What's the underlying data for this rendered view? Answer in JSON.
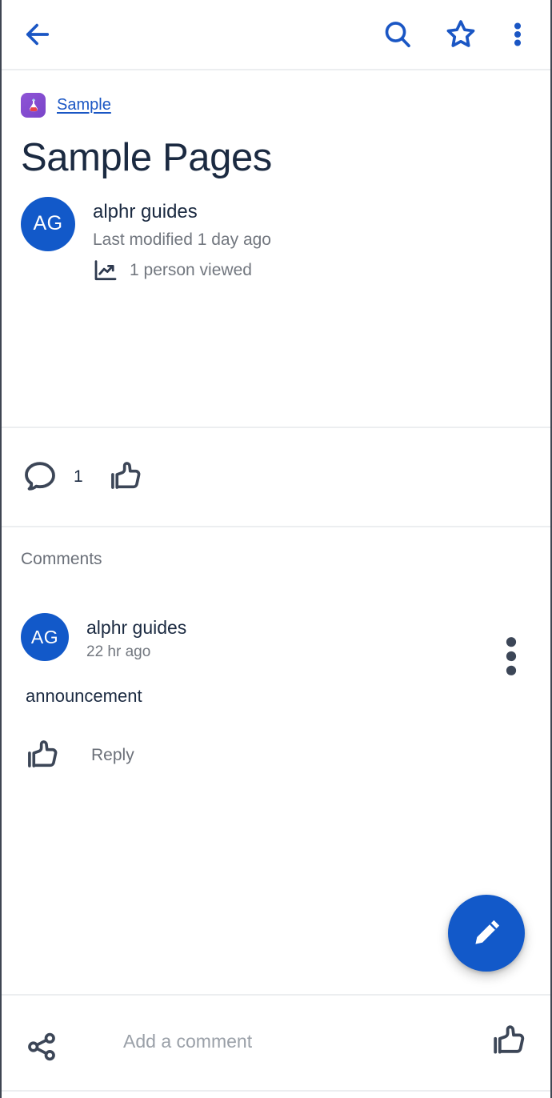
{
  "appbar": {
    "back_icon": "arrow-left-icon",
    "search_icon": "search-icon",
    "favorite_icon": "star-outline-icon",
    "overflow_icon": "more-vertical-icon",
    "icon_color": "#1a56c4"
  },
  "page": {
    "breadcrumb": {
      "space_icon": "flask-icon",
      "space_label": "Sample"
    },
    "title": "Sample Pages",
    "byline": {
      "avatar_initials": "AG",
      "avatar_color": "#1259c9",
      "author": "alphr guides",
      "modified": "Last modified 1 day ago",
      "views_icon": "analytics-chart-icon",
      "views": "1 person viewed"
    }
  },
  "engagement": {
    "comment_icon": "comment-bubble-icon",
    "comment_count": "1",
    "like_icon": "thumbs-up-icon"
  },
  "comments": {
    "heading": "Comments",
    "items": [
      {
        "avatar_initials": "AG",
        "author": "alphr guides",
        "time": "22 hr ago",
        "body": "announcement",
        "like_icon": "thumbs-up-icon",
        "reply_label": "Reply",
        "menu_icon": "more-vertical-icon"
      }
    ]
  },
  "fab": {
    "icon": "pencil-edit-icon",
    "color": "#1259c9"
  },
  "bottombar": {
    "share_icon": "share-icon",
    "comment_placeholder": "Add a comment",
    "comment_value": "",
    "like_icon": "thumbs-up-icon"
  }
}
